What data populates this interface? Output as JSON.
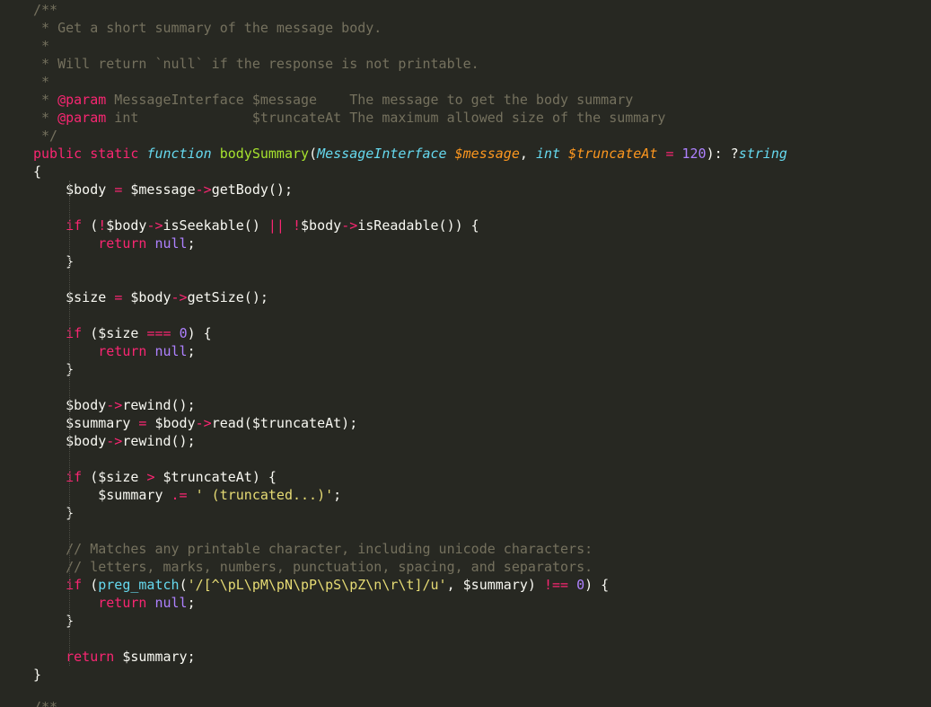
{
  "lines": [
    [
      {
        "t": "/**",
        "c": "c"
      }
    ],
    [
      {
        "t": " * Get a short summary of the message body.",
        "c": "c"
      }
    ],
    [
      {
        "t": " *",
        "c": "c"
      }
    ],
    [
      {
        "t": " * Will return `null` if the response is not printable.",
        "c": "c"
      }
    ],
    [
      {
        "t": " *",
        "c": "c"
      }
    ],
    [
      {
        "t": " * ",
        "c": "c"
      },
      {
        "t": "@param",
        "c": "pd"
      },
      {
        "t": " MessageInterface $message    The message to get the body summary",
        "c": "c"
      }
    ],
    [
      {
        "t": " * ",
        "c": "c"
      },
      {
        "t": "@param",
        "c": "pd"
      },
      {
        "t": " int              $truncateAt The maximum allowed size of the summary",
        "c": "c"
      }
    ],
    [
      {
        "t": " */",
        "c": "c"
      }
    ],
    [
      {
        "t": "public",
        "c": "k"
      },
      {
        "t": " "
      },
      {
        "t": "static",
        "c": "k"
      },
      {
        "t": " "
      },
      {
        "t": "function",
        "c": "fk"
      },
      {
        "t": " "
      },
      {
        "t": "bodySummary",
        "c": "fn"
      },
      {
        "t": "("
      },
      {
        "t": "MessageInterface",
        "c": "ty"
      },
      {
        "t": " "
      },
      {
        "t": "$message",
        "c": "pr"
      },
      {
        "t": ", "
      },
      {
        "t": "int",
        "c": "ty"
      },
      {
        "t": " "
      },
      {
        "t": "$truncateAt",
        "c": "pr"
      },
      {
        "t": " "
      },
      {
        "t": "=",
        "c": "o"
      },
      {
        "t": " "
      },
      {
        "t": "120",
        "c": "n"
      },
      {
        "t": "): ?"
      },
      {
        "t": "string",
        "c": "ty"
      }
    ],
    [
      {
        "t": "{"
      }
    ],
    [
      {
        "t": "    $body "
      },
      {
        "t": "=",
        "c": "o"
      },
      {
        "t": " $message"
      },
      {
        "t": "->",
        "c": "o"
      },
      {
        "t": "getBody();"
      }
    ],
    [
      {
        "t": ""
      }
    ],
    [
      {
        "t": "    "
      },
      {
        "t": "if",
        "c": "k"
      },
      {
        "t": " ("
      },
      {
        "t": "!",
        "c": "o"
      },
      {
        "t": "$body"
      },
      {
        "t": "->",
        "c": "o"
      },
      {
        "t": "isSeekable() "
      },
      {
        "t": "||",
        "c": "o"
      },
      {
        "t": " "
      },
      {
        "t": "!",
        "c": "o"
      },
      {
        "t": "$body"
      },
      {
        "t": "->",
        "c": "o"
      },
      {
        "t": "isReadable()) {"
      }
    ],
    [
      {
        "t": "        "
      },
      {
        "t": "return",
        "c": "k"
      },
      {
        "t": " "
      },
      {
        "t": "null",
        "c": "n"
      },
      {
        "t": ";"
      }
    ],
    [
      {
        "t": "    }"
      }
    ],
    [
      {
        "t": ""
      }
    ],
    [
      {
        "t": "    $size "
      },
      {
        "t": "=",
        "c": "o"
      },
      {
        "t": " $body"
      },
      {
        "t": "->",
        "c": "o"
      },
      {
        "t": "getSize();"
      }
    ],
    [
      {
        "t": ""
      }
    ],
    [
      {
        "t": "    "
      },
      {
        "t": "if",
        "c": "k"
      },
      {
        "t": " ($size "
      },
      {
        "t": "===",
        "c": "o"
      },
      {
        "t": " "
      },
      {
        "t": "0",
        "c": "n"
      },
      {
        "t": ") {"
      }
    ],
    [
      {
        "t": "        "
      },
      {
        "t": "return",
        "c": "k"
      },
      {
        "t": " "
      },
      {
        "t": "null",
        "c": "n"
      },
      {
        "t": ";"
      }
    ],
    [
      {
        "t": "    }"
      }
    ],
    [
      {
        "t": ""
      }
    ],
    [
      {
        "t": "    $body"
      },
      {
        "t": "->",
        "c": "o"
      },
      {
        "t": "rewind();"
      }
    ],
    [
      {
        "t": "    $summary "
      },
      {
        "t": "=",
        "c": "o"
      },
      {
        "t": " $body"
      },
      {
        "t": "->",
        "c": "o"
      },
      {
        "t": "read($truncateAt);"
      }
    ],
    [
      {
        "t": "    $body"
      },
      {
        "t": "->",
        "c": "o"
      },
      {
        "t": "rewind();"
      }
    ],
    [
      {
        "t": ""
      }
    ],
    [
      {
        "t": "    "
      },
      {
        "t": "if",
        "c": "k"
      },
      {
        "t": " ($size "
      },
      {
        "t": ">",
        "c": "o"
      },
      {
        "t": " $truncateAt) {"
      }
    ],
    [
      {
        "t": "        $summary "
      },
      {
        "t": ".=",
        "c": "o"
      },
      {
        "t": " "
      },
      {
        "t": "' (truncated...)'",
        "c": "s"
      },
      {
        "t": ";"
      }
    ],
    [
      {
        "t": "    }"
      }
    ],
    [
      {
        "t": ""
      }
    ],
    [
      {
        "t": "    "
      },
      {
        "t": "// Matches any printable character, including unicode characters:",
        "c": "c"
      }
    ],
    [
      {
        "t": "    "
      },
      {
        "t": "// letters, marks, numbers, punctuation, spacing, and separators.",
        "c": "c"
      }
    ],
    [
      {
        "t": "    "
      },
      {
        "t": "if",
        "c": "k"
      },
      {
        "t": " ("
      },
      {
        "t": "preg_match",
        "c": "st"
      },
      {
        "t": "("
      },
      {
        "t": "'/[^\\pL\\pM\\pN\\pP\\pS\\pZ\\n\\r\\t]/u'",
        "c": "s"
      },
      {
        "t": ", $summary) "
      },
      {
        "t": "!==",
        "c": "o"
      },
      {
        "t": " "
      },
      {
        "t": "0",
        "c": "n"
      },
      {
        "t": ") {"
      }
    ],
    [
      {
        "t": "        "
      },
      {
        "t": "return",
        "c": "k"
      },
      {
        "t": " "
      },
      {
        "t": "null",
        "c": "n"
      },
      {
        "t": ";"
      }
    ],
    [
      {
        "t": "    }"
      }
    ],
    [
      {
        "t": ""
      }
    ],
    [
      {
        "t": "    "
      },
      {
        "t": "return",
        "c": "k"
      },
      {
        "t": " $summary;"
      }
    ],
    [
      {
        "t": "}"
      }
    ]
  ],
  "trailing_fragment": "/**",
  "colors": {
    "background": "#272822",
    "text": "#F8F8F2",
    "comment": "#75715E",
    "keyword": "#F92672",
    "storage": "#66D9EF",
    "function_name": "#A6E22E",
    "parameter": "#FD971F",
    "number": "#AE81FF",
    "string": "#E6DB74"
  }
}
